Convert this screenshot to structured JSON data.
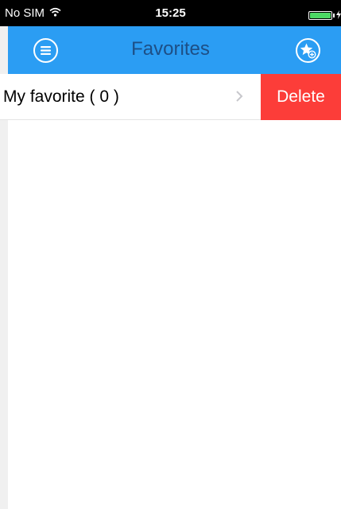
{
  "status_bar": {
    "carrier": "No SIM",
    "time": "15:25",
    "battery_level": 1.0
  },
  "nav": {
    "title": "Favorites",
    "left_icon": "menu-circle-icon",
    "right_icon": "star-add-icon"
  },
  "list": {
    "items": [
      {
        "label": "My favorite ( 0 )",
        "chevron_icon": "chevron-right-icon"
      }
    ],
    "delete_label": "Delete"
  },
  "colors": {
    "nav_background": "#2b9df3",
    "nav_title": "#1d4f86",
    "delete": "#fc3d39",
    "battery": "#4cd964",
    "status_bar": "#000000"
  }
}
